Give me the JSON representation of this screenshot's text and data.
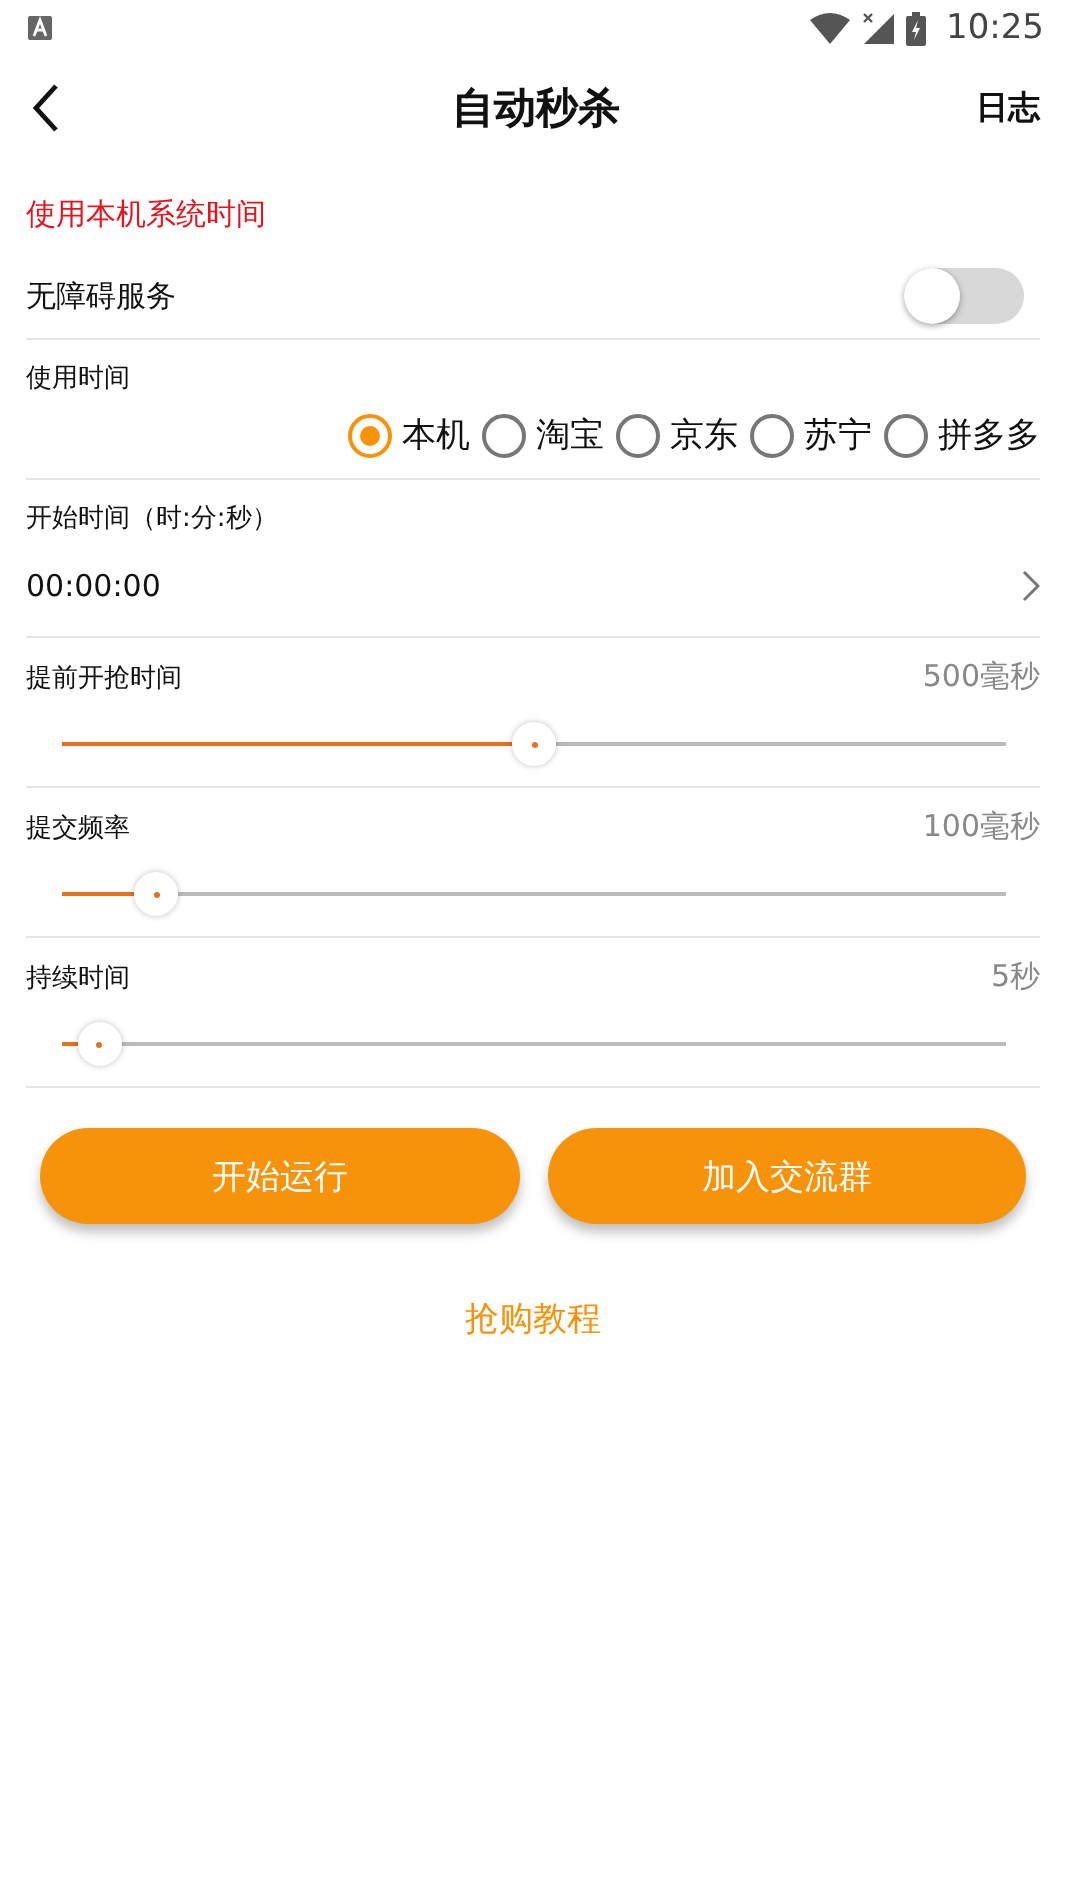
{
  "status_bar": {
    "time": "10:25"
  },
  "header": {
    "title": "自动秒杀",
    "action": "日志"
  },
  "notice": "使用本机系统时间",
  "accessibility": {
    "label": "无障碍服务",
    "on": false
  },
  "time_source": {
    "label": "使用时间",
    "options": [
      {
        "label": "本机",
        "selected": true
      },
      {
        "label": "淘宝",
        "selected": false
      },
      {
        "label": "京东",
        "selected": false
      },
      {
        "label": "苏宁",
        "selected": false
      },
      {
        "label": "拼多多",
        "selected": false
      }
    ]
  },
  "start_time": {
    "label": "开始时间（时:分:秒）",
    "value": "00:00:00"
  },
  "sliders": [
    {
      "label": "提前开抢时间",
      "reading": "500毫秒",
      "level": 0.5
    },
    {
      "label": "提交频率",
      "reading": "100毫秒",
      "level": 0.1
    },
    {
      "label": "持续时间",
      "reading": "5秒",
      "level": 0.04
    }
  ],
  "buttons": [
    "开始运行",
    "加入交流群"
  ],
  "tutorial_link": "抢购教程"
}
